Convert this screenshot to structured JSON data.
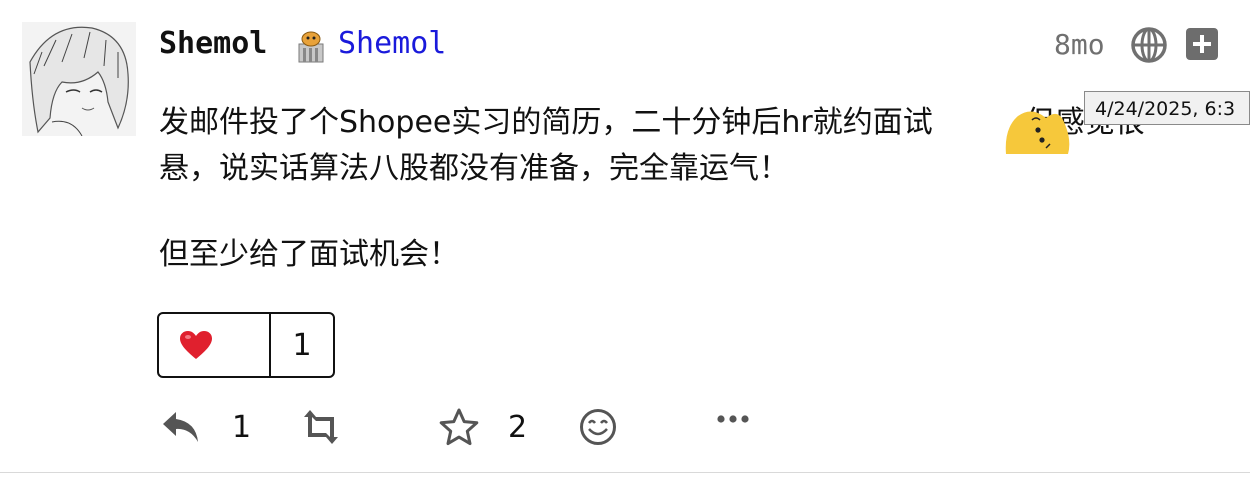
{
  "post": {
    "display_name": "Shemol",
    "handle": "Shemol",
    "relative_time": "8mo",
    "tooltip_time": "4/24/2025, 6:3",
    "body": {
      "line1": "发邮件投了个Shopee实习的简历，二十分钟后hr就约面试",
      "line1_tail": "但感觉很",
      "line2": "悬，说实话算法八股都没有准备，完全靠运气！",
      "line3": "但至少给了面试机会！"
    },
    "reaction": {
      "emoji": "❤️",
      "count": "1"
    },
    "actions": {
      "reply_count": "1",
      "favourite_count": "2"
    }
  },
  "icons": {
    "avatar": "anime-avatar",
    "badge": "bot-badge-icon",
    "visibility": "globe-icon",
    "expand": "plus-icon",
    "reply": "reply-icon",
    "boost": "boost-icon",
    "favourite": "star-icon",
    "emoji_reaction": "smile-icon",
    "more": "ellipsis-icon"
  },
  "colors": {
    "handle": "#1a1adb",
    "muted": "#707070"
  }
}
